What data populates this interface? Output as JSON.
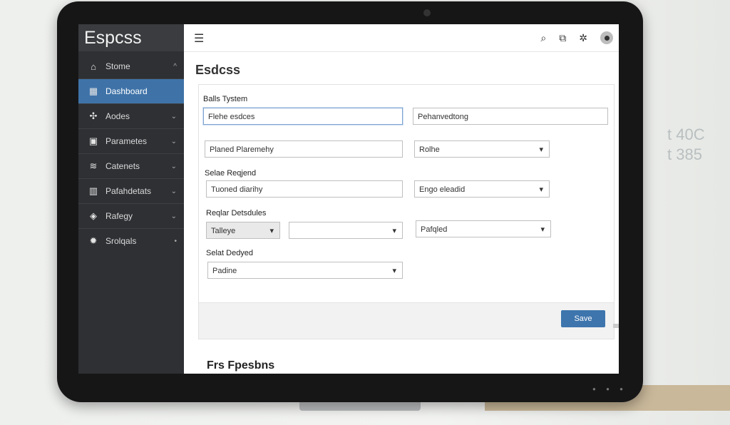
{
  "app": {
    "brand": "Espcss"
  },
  "sidebar": {
    "items": [
      {
        "label": "Stome",
        "icon": "home-icon",
        "glyph": "⌂",
        "chevron": "^"
      },
      {
        "label": "Dashboard",
        "icon": "dashboard-icon",
        "glyph": "▦",
        "chevron": ""
      },
      {
        "label": "Aodes",
        "icon": "nodes-icon",
        "glyph": "✣",
        "chevron": "⌄"
      },
      {
        "label": "Parametes",
        "icon": "parameters-icon",
        "glyph": "▣",
        "chevron": "⌄"
      },
      {
        "label": "Catenets",
        "icon": "database-icon",
        "glyph": "≋",
        "chevron": "⌄"
      },
      {
        "label": "Pafahdetats",
        "icon": "files-icon",
        "glyph": "▥",
        "chevron": "⌄"
      },
      {
        "label": "Rafegy",
        "icon": "shield-icon",
        "glyph": "◈",
        "chevron": "⌄"
      },
      {
        "label": "Srolqals",
        "icon": "gear-icon",
        "glyph": "✹",
        "chevron": "•"
      }
    ]
  },
  "header": {
    "title": "Esdcss"
  },
  "form": {
    "section1_label": "Balls Tystem",
    "field1_value": "Flehe esdces",
    "field2_value": "Pehanvedtong",
    "field3_value": "Planed Plaremehy",
    "select1_value": "Rolhe",
    "section2_label": "Selae Reqjend",
    "field4_value": "Tuoned diarihy",
    "select2_value": "Engo eleadid",
    "section3_label": "Reqlar Detsdules",
    "select3_value": "Talleye",
    "select4_value": "",
    "select5_value": "Pafqled",
    "section4_label": "Selat Dedyed",
    "select6_value": "Padine",
    "save_label": "Save"
  },
  "below_heading": "Frs Fpesbns",
  "wall": {
    "line1": "t 40C",
    "line2": "t 385"
  },
  "colors": {
    "accent": "#3e75ad",
    "sidebar": "#2e3033",
    "active": "#3f73a8"
  }
}
